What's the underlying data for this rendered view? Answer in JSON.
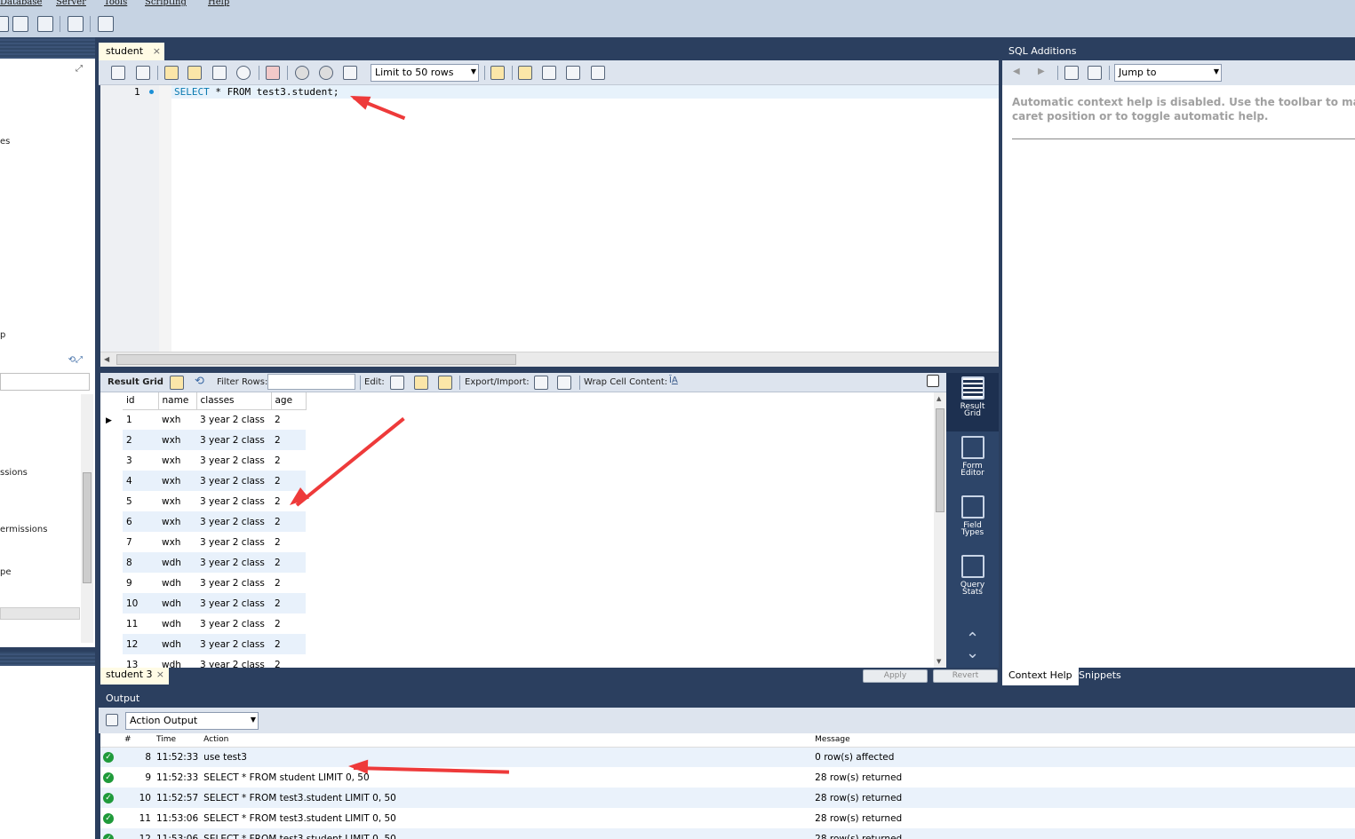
{
  "menu": [
    "Database",
    "Server",
    "Tools",
    "Scripting",
    "Help"
  ],
  "query_tab": {
    "label": "student",
    "close": "×"
  },
  "editor_toolbar": {
    "limit_select": "Limit to 50 rows"
  },
  "editor": {
    "line_number": "1",
    "sql_keyword": "SELECT",
    "sql_rest": " * FROM test3.student;"
  },
  "left_panel": {
    "items": [
      "es",
      "p",
      "ssions",
      "ermissions",
      "pe"
    ]
  },
  "result_toolbar": {
    "result_grid": "Result Grid",
    "filter_rows": "Filter Rows:",
    "edit": "Edit:",
    "export_import": "Export/Import:",
    "wrap_cell": "Wrap Cell Content:"
  },
  "grid": {
    "columns": [
      "id",
      "name",
      "classes",
      "age"
    ],
    "rows": [
      [
        "1",
        "wxh",
        "3 year 2 class",
        "2"
      ],
      [
        "2",
        "wxh",
        "3 year 2 class",
        "2"
      ],
      [
        "3",
        "wxh",
        "3 year 2 class",
        "2"
      ],
      [
        "4",
        "wxh",
        "3 year 2 class",
        "2"
      ],
      [
        "5",
        "wxh",
        "3 year 2 class",
        "2"
      ],
      [
        "6",
        "wxh",
        "3 year 2 class",
        "2"
      ],
      [
        "7",
        "wxh",
        "3 year 2 class",
        "2"
      ],
      [
        "8",
        "wdh",
        "3 year 2 class",
        "2"
      ],
      [
        "9",
        "wdh",
        "3 year 2 class",
        "2"
      ],
      [
        "10",
        "wdh",
        "3 year 2 class",
        "2"
      ],
      [
        "11",
        "wdh",
        "3 year 2 class",
        "2"
      ],
      [
        "12",
        "wdh",
        "3 year 2 class",
        "2"
      ],
      [
        "13",
        "wdh",
        "3 year 2 class",
        "2"
      ]
    ]
  },
  "side_icons": [
    {
      "line1": "Result",
      "line2": "Grid"
    },
    {
      "line1": "Form",
      "line2": "Editor"
    },
    {
      "line1": "Field",
      "line2": "Types"
    },
    {
      "line1": "Query",
      "line2": "Stats"
    }
  ],
  "bottom": {
    "result_tab": "student 3",
    "apply": "Apply",
    "revert": "Revert"
  },
  "output": {
    "title": "Output",
    "select": "Action Output",
    "columns": [
      "#",
      "Time",
      "Action",
      "Message"
    ],
    "rows": [
      {
        "n": "8",
        "time": "11:52:33",
        "action": "use test3",
        "message": "0 row(s) affected"
      },
      {
        "n": "9",
        "time": "11:52:33",
        "action": "SELECT * FROM student LIMIT 0, 50",
        "message": "28 row(s) returned"
      },
      {
        "n": "10",
        "time": "11:52:57",
        "action": "SELECT * FROM test3.student LIMIT 0, 50",
        "message": "28 row(s) returned"
      },
      {
        "n": "11",
        "time": "11:53:06",
        "action": "SELECT * FROM test3.student LIMIT 0, 50",
        "message": "28 row(s) returned"
      },
      {
        "n": "12",
        "time": "11:53:06",
        "action": "SELECT * FROM test3.student LIMIT 0, 50",
        "message": "28 row(s) returned"
      }
    ]
  },
  "sql_additions": {
    "title": "SQL Additions",
    "jump_to": "Jump to",
    "help_line1": "Automatic context help is disabled. Use the toolbar to manu",
    "help_line2": "caret position or to toggle automatic help.",
    "tabs": [
      "Context Help",
      "Snippets"
    ]
  },
  "colors": {
    "chrome": "#2b3f5f",
    "toolbar": "#dde4ee",
    "annotation_arrow": "#ee3a3a",
    "ok_status": "#1f9a3a"
  }
}
